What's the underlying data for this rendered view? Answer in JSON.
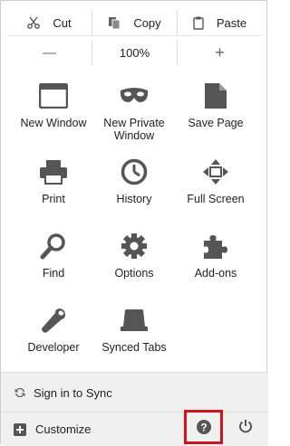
{
  "edit": {
    "cut_label": "Cut",
    "copy_label": "Copy",
    "paste_label": "Paste",
    "icons": [
      "scissors-icon",
      "copy-icon",
      "paste-icon"
    ]
  },
  "zoom": {
    "minus_label": "—",
    "level": "100%",
    "plus_label": "+"
  },
  "menu": {
    "items": [
      {
        "label": "New Window",
        "icon": "new-window-icon"
      },
      {
        "label": "New Private\nWindow",
        "icon": "mask-icon"
      },
      {
        "label": "Save Page",
        "icon": "save-page-icon"
      },
      {
        "label": "Print",
        "icon": "printer-icon"
      },
      {
        "label": "History",
        "icon": "clock-icon"
      },
      {
        "label": "Full Screen",
        "icon": "fullscreen-icon"
      },
      {
        "label": "Find",
        "icon": "magnifier-icon"
      },
      {
        "label": "Options",
        "icon": "gear-icon"
      },
      {
        "label": "Add-ons",
        "icon": "puzzle-icon"
      },
      {
        "label": "Developer",
        "icon": "wrench-icon"
      },
      {
        "label": "Synced Tabs",
        "icon": "synced-tabs-icon"
      }
    ]
  },
  "footer": {
    "sync_label": "Sign in to Sync",
    "customize_label": "Customize",
    "help_icon": "help-icon",
    "power_icon": "power-icon",
    "highlight_color": "#d0141a"
  }
}
